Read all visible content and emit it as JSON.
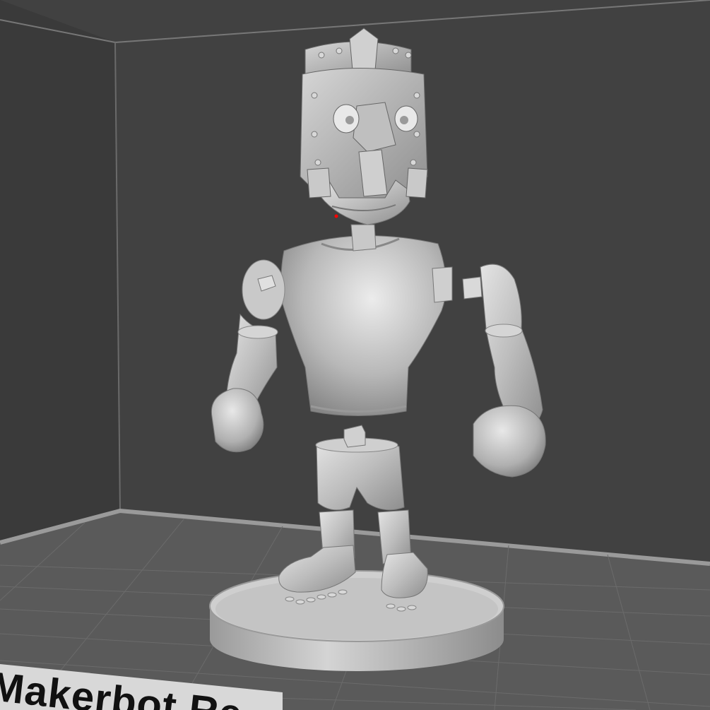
{
  "viewer": {
    "brand_label": "Makerbot Re",
    "colors": {
      "background_wall": "#414141",
      "left_wall": "#3a3a3a",
      "floor": "#5a5a5a",
      "build_plate_edge": "#8a8a8a",
      "model": "#bdbdbd",
      "highlight": "#e6e6e6",
      "error_mark": "#ff0000"
    }
  },
  "model": {
    "name": "figurine",
    "parts": [
      "helmet-head",
      "neck-peg",
      "torso",
      "left-arm",
      "right-arm",
      "waist-peg",
      "shorts",
      "left-leg-boot",
      "right-leg-boot",
      "round-base"
    ]
  }
}
